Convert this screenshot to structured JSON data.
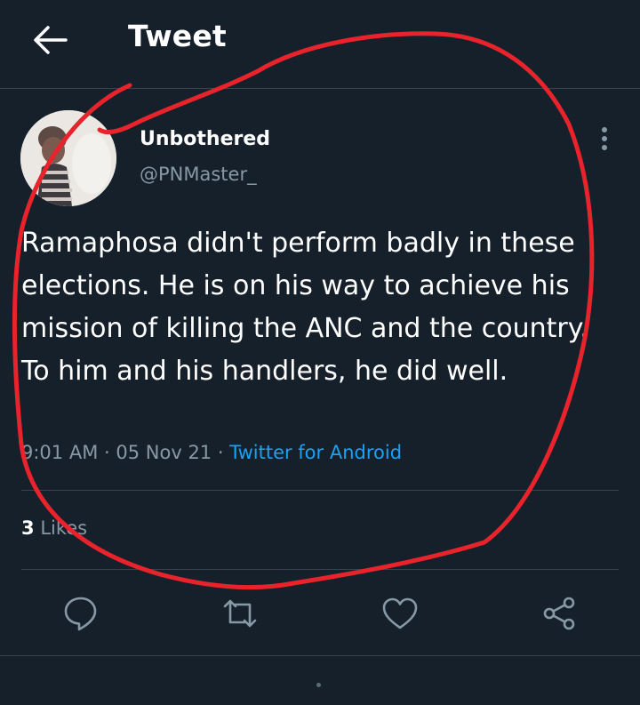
{
  "header": {
    "title": "Tweet",
    "back_icon": "arrow-left-icon"
  },
  "author": {
    "name": "Unbothered",
    "handle": "@PNMaster_"
  },
  "tweet": {
    "text": "Ramaphosa didn't perform badly in these elections. He is on his way to achieve his mission of killing the ANC and the country. To him and his handlers, he did well.",
    "time": "9:01 AM",
    "date": "05 Nov 21",
    "separator": "·",
    "source": "Twitter for Android"
  },
  "stats": {
    "likes_count": "3",
    "likes_label": "Likes"
  },
  "actions": [
    {
      "name": "reply",
      "icon": "speech-bubble-icon"
    },
    {
      "name": "retweet",
      "icon": "retweet-icon"
    },
    {
      "name": "like",
      "icon": "heart-icon"
    },
    {
      "name": "share",
      "icon": "share-icon"
    }
  ],
  "colors": {
    "background": "#15202b",
    "divider": "#38444d",
    "secondary_text": "#8899a6",
    "link": "#1da1f2",
    "annotation": "#e8232b"
  }
}
